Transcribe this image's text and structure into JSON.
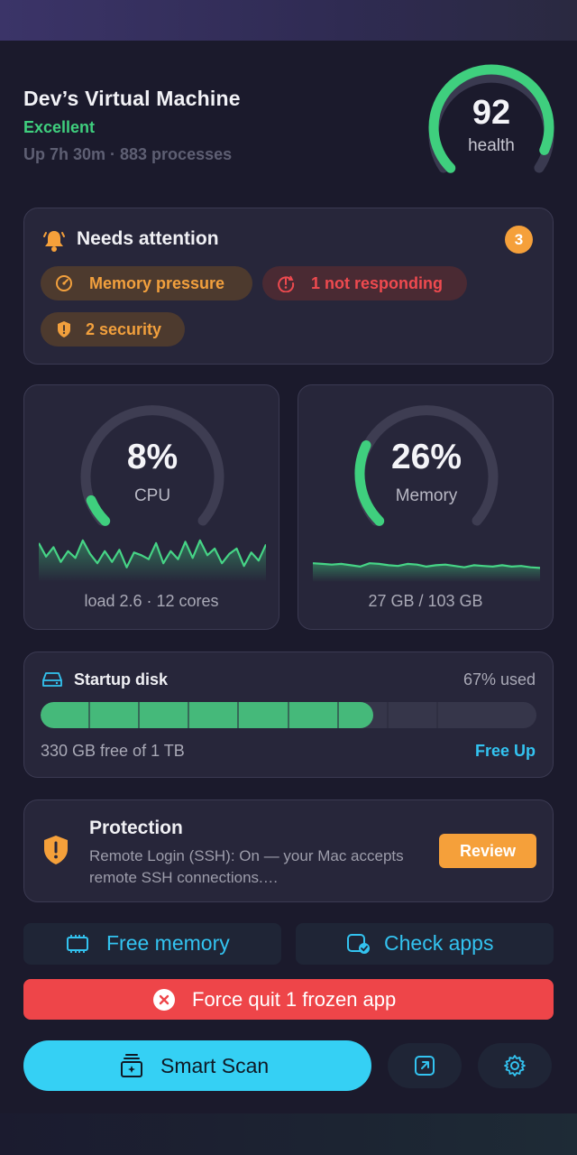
{
  "header": {
    "machine_name": "Dev’s Virtual Machine",
    "status": "Excellent",
    "uptime": "Up 7h 30m · 883 processes"
  },
  "health": {
    "score": "92",
    "label": "health",
    "fraction": 0.92
  },
  "attention": {
    "title": "Needs attention",
    "count": "3",
    "chips": [
      {
        "label": "Memory pressure",
        "icon": "gauge-icon",
        "tone": "warning"
      },
      {
        "label": "1 not responding",
        "icon": "alert-clock-icon",
        "tone": "critical"
      },
      {
        "label": "2 security",
        "icon": "shield-icon",
        "tone": "warning"
      }
    ]
  },
  "cpu": {
    "value": "8%",
    "label": "CPU",
    "percent": 8,
    "footer": "load 2.6 · 12 cores",
    "history": [
      58,
      38,
      52,
      30,
      46,
      36,
      62,
      42,
      28,
      46,
      30,
      48,
      22,
      44,
      40,
      34,
      58,
      28,
      46,
      34,
      60,
      36,
      62,
      40,
      50,
      28,
      42,
      50,
      24,
      44,
      32,
      56
    ]
  },
  "memory": {
    "value": "26%",
    "label": "Memory",
    "percent": 26,
    "footer": "27 GB / 103 GB",
    "history": [
      28,
      27,
      26,
      27,
      25,
      23,
      28,
      27,
      25,
      24,
      27,
      26,
      23,
      25,
      26,
      24,
      22,
      25,
      24,
      23,
      25,
      23,
      24,
      22,
      21
    ]
  },
  "disk": {
    "title": "Startup disk",
    "used_text": "67% used",
    "used_fraction": 0.67,
    "free_text": "330 GB free of 1 TB",
    "action": "Free Up"
  },
  "protection": {
    "title": "Protection",
    "description": "Remote Login (SSH): On — your Mac accepts remote SSH connections.…",
    "action": "Review"
  },
  "actions": {
    "free_memory": "Free memory",
    "check_apps": "Check apps",
    "force_quit": "Force quit 1 frozen app",
    "smart_scan": "Smart Scan"
  },
  "colors": {
    "accent": "#35d0f4",
    "success": "#3fcf7e",
    "warning": "#f5a03a",
    "danger": "#ee4549",
    "card": "#27263a"
  }
}
